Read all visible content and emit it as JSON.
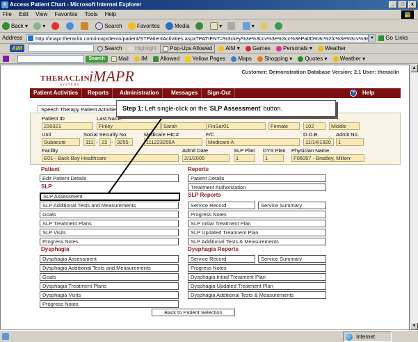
{
  "window": {
    "title": "Access Patient Chart - Microsoft Internet Explorer",
    "buttons": [
      "_",
      "□",
      "x"
    ]
  },
  "menu": [
    "File",
    "Edit",
    "View",
    "Favorites",
    "Tools",
    "Help"
  ],
  "toolbar": {
    "back": "Back",
    "search": "Search",
    "favorites": "Favorites",
    "media": "Media"
  },
  "address": {
    "label": "Address",
    "url": "http://imapr.theraclin.com/imaprdemo/patient/STPatientActivities.aspx?PATIENT=%3ckey%3e%3ccv%3e%3cc%3ePatID%3c%2fc%3e%3cv%3e2303",
    "go": "Go",
    "links": "Links"
  },
  "aim": {
    "logo": "AIM",
    "search": "Search",
    "highlight": "Highlight",
    "popups": "Pop-Ups Allowed",
    "aim_menu": "AIM",
    "games": "Games",
    "personals": "Personals",
    "weather": "Weather"
  },
  "yahoo": {
    "search": "Search",
    "mail": "Mail",
    "im": "IM",
    "allowed": "Allowed",
    "yellow_pages": "Yellow Pages",
    "maps": "Maps",
    "shopping": "Shopping",
    "quotes": "Quotes",
    "weather": "Weather"
  },
  "app": {
    "logo_thera": "THERACLIN",
    "logo_systems": "SYSTEMS",
    "logo_imapr": "iMAPR",
    "customer": "Customer: Demonstration Database Version: 2.1 User: theraclin",
    "nav": [
      "Patient Activities",
      "Reports",
      "Administration",
      "Messages",
      "Sign-Out"
    ],
    "help": "Help",
    "tab": "Speech Therapy Patient Activities",
    "callout_step": "Step 1:",
    "callout_pre": " Left single-click on the '",
    "callout_target": "SLP Assessment",
    "callout_post": "' button."
  },
  "patient": {
    "labels": {
      "patient_id": "Patient ID",
      "last_name": "Last Name",
      "unit": "Unit",
      "ssn": "Social Security No.",
      "medicare": "Medicare HIC#",
      "fc": "F/C",
      "dob": "D.O.B.",
      "admit_no": "Admit No.",
      "facility": "Facility",
      "admit_date": "Admit Date",
      "slp_plan": "SLP Plan",
      "dys_plan": "DYS Plan",
      "physician": "Physician Name"
    },
    "patient_id": "230321",
    "last_name": "Finley",
    "first_name": "Sarah",
    "account": "FinSar01",
    "sex": "Female",
    "room": "102",
    "middle": "Middle",
    "unit": "Subacute",
    "ssn1": "111",
    "ssn2": "22",
    "ssn3": "3255",
    "medicare": "111223255A",
    "fc": "Medicare A",
    "dob": "11/14/1920",
    "admit_no": "1",
    "facility": "E01 - Back Bay Healthcare",
    "admit_date": "2/1/2005",
    "slp_plan": "1",
    "dys_plan": "1",
    "physician": "F06057 - Bradley, Milton"
  },
  "left": {
    "patient_title": "Patient",
    "patient_buttons": [
      "Edit Patient Details"
    ],
    "slp_title": "SLP",
    "slp_buttons": [
      "SLP Assessment",
      "SLP Additional Tests and Measurements",
      "Goals",
      "SLP Treatment Plans",
      "SLP Visits",
      "Progress Notes"
    ],
    "dys_title": "Dysphagia",
    "dys_buttons": [
      "Dysphagia Assessment",
      "Dysphagia Additional Tests and Measurements",
      "Goals",
      "Dysphagia Treatment Plans",
      "Dysphagia Visits",
      "Progress Notes"
    ]
  },
  "right": {
    "reports_title": "Reports",
    "reports_buttons": [
      "Patient Details",
      "Treatment Authorization"
    ],
    "slp_reports_title": "SLP Reports",
    "service_record": "Service Record",
    "service_summary": "Service Summary",
    "slp_reports_buttons": [
      "Progress Notes",
      "SLP Initial Treatment Plan",
      "SLP Updated Treatment Plan",
      "SLP Additional Tests & Measurements"
    ],
    "dys_reports_title": "Dysphagia Reports",
    "dys_service_record": "Service Record",
    "dys_service_summary": "Service Summary",
    "dys_reports_buttons": [
      "Progress Notes",
      "Dysphagia Initial Treatment Plan",
      "Dysphagia Updated Treatment Plan",
      "Dysphagia Additional Tests & Measurements"
    ]
  },
  "back_button": "Back to Patient Selection",
  "status": {
    "zone": "Internet"
  },
  "colors": {
    "nav_bg": "#7a1010",
    "section_title": "#8b1a1a",
    "field_bg": "#f7eab6",
    "title_bar": "#0a246a"
  }
}
